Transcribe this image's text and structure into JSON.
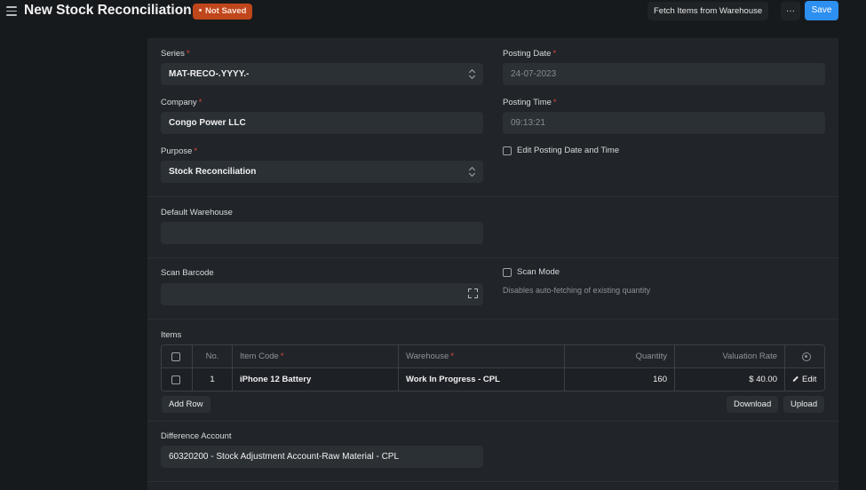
{
  "header": {
    "title": "New Stock Reconciliation",
    "status": "Not Saved",
    "fetch_label": "Fetch Items from Warehouse",
    "more_label": "···",
    "save_label": "Save"
  },
  "form": {
    "series": {
      "label": "Series",
      "value": "MAT-RECO-.YYYY.-"
    },
    "company": {
      "label": "Company",
      "value": "Congo Power LLC"
    },
    "purpose": {
      "label": "Purpose",
      "value": "Stock Reconciliation"
    },
    "posting_date": {
      "label": "Posting Date",
      "value": "24-07-2023"
    },
    "posting_time": {
      "label": "Posting Time",
      "value": "09:13:21"
    },
    "edit_posting": {
      "label": "Edit Posting Date and Time",
      "checked": false
    },
    "default_warehouse": {
      "label": "Default Warehouse",
      "value": ""
    },
    "scan_barcode": {
      "label": "Scan Barcode",
      "value": ""
    },
    "scan_mode": {
      "label": "Scan Mode",
      "help": "Disables auto-fetching of existing quantity",
      "checked": false
    },
    "difference_account": {
      "label": "Difference Account",
      "value": "60320200 - Stock Adjustment Account-Raw Material - CPL"
    }
  },
  "items": {
    "label": "Items",
    "columns": {
      "no": "No.",
      "item_code": "Item Code",
      "warehouse": "Warehouse",
      "quantity": "Quantity",
      "valuation_rate": "Valuation Rate"
    },
    "rows": [
      {
        "no": "1",
        "item_code": "iPhone 12 Battery",
        "warehouse": "Work In Progress - CPL",
        "quantity": "160",
        "valuation_rate": "$ 40.00",
        "edit": "Edit"
      }
    ],
    "add_row": "Add Row",
    "download": "Download",
    "upload": "Upload"
  },
  "colors": {
    "background": "#171a1d",
    "card": "#212529",
    "primary": "#2d8ff0",
    "badge": "#c0461b",
    "required": "#e2463a"
  }
}
